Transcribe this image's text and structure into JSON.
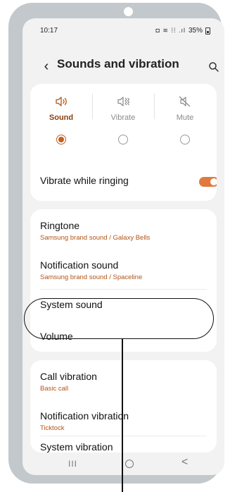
{
  "status_bar": {
    "time": "10:17",
    "icons": "◘ ≋ ⁞⁞ .ıl",
    "battery": "35%"
  },
  "header": {
    "title": "Sounds and vibration",
    "back_icon": "chevron-left-icon",
    "search_icon": "search-icon"
  },
  "sound_mode": {
    "options": [
      {
        "label": "Sound",
        "icon": "speaker-icon",
        "selected": true
      },
      {
        "label": "Vibrate",
        "icon": "vibrate-icon",
        "selected": false
      },
      {
        "label": "Mute",
        "icon": "mute-icon",
        "selected": false
      }
    ]
  },
  "vibrate_while_ringing": {
    "label": "Vibrate while ringing",
    "enabled": true
  },
  "sound_settings": [
    {
      "title": "Ringtone",
      "subtitle": "Samsung brand sound / Galaxy Bells"
    },
    {
      "title": "Notification sound",
      "subtitle": "Samsung brand sound / Spaceline"
    },
    {
      "title": "System sound",
      "subtitle": ""
    },
    {
      "title": "Volume",
      "subtitle": ""
    }
  ],
  "vibration_settings": [
    {
      "title": "Call vibration",
      "subtitle": "Basic call"
    },
    {
      "title": "Notification vibration",
      "subtitle": "Ticktock"
    },
    {
      "title": "System vibration",
      "subtitle": ""
    }
  ],
  "nav_bar": {
    "recent": "III",
    "back": "<"
  },
  "colors": {
    "accent": "#c25f21",
    "toggle_on": "#e07a3f",
    "subtitle": "#b25416",
    "screen_bg": "#f2f2f2",
    "phone_frame": "#c2c8cb"
  }
}
